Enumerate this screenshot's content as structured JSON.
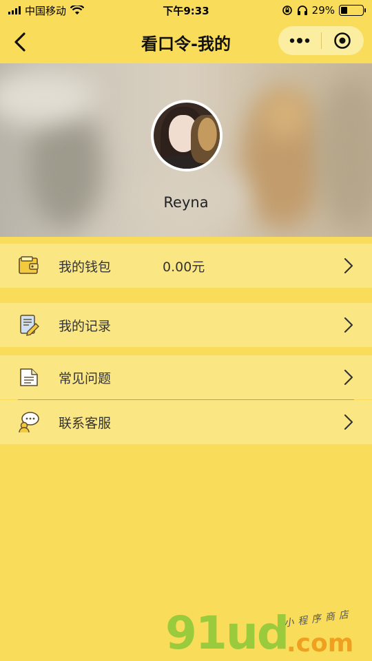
{
  "status_bar": {
    "carrier": "中国移动",
    "time": "下午9:33",
    "battery_percent": "29%",
    "battery_level": 0.29
  },
  "nav": {
    "title": "看口令-我的"
  },
  "profile": {
    "username": "Reyna"
  },
  "menu": {
    "wallet": {
      "label": "我的钱包",
      "value": "0.00元",
      "icon": "wallet-icon"
    },
    "records": {
      "label": "我的记录",
      "icon": "records-icon"
    },
    "faq": {
      "label": "常见问题",
      "icon": "document-icon"
    },
    "support": {
      "label": "联系客服",
      "icon": "customer-service-icon"
    }
  },
  "watermark": {
    "brand": "91ud",
    "domain": ".com",
    "tagline": "小程序商店"
  },
  "colors": {
    "background": "#f8dc5a",
    "row": "#fae784",
    "capsule": "#fbeea0"
  }
}
